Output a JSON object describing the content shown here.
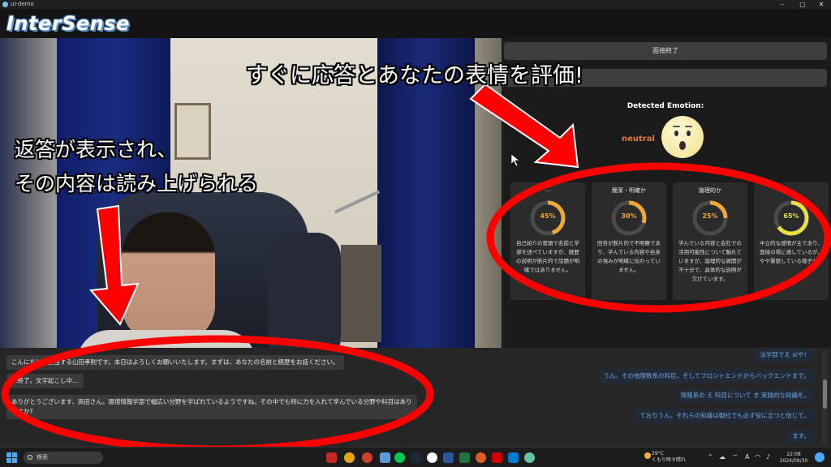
{
  "window": {
    "title": "ui-demo",
    "controls": [
      "–",
      "▢",
      "✕"
    ]
  },
  "app": {
    "logo": "InterSense"
  },
  "captions": {
    "top_right": "すぐに応答とあなたの表情を評価!",
    "left_line1": "返答が表示され、",
    "left_line2": "その内容は読み上げられる"
  },
  "panel": {
    "end_button": "面接終了",
    "second_button": "",
    "emotion_label": "Detected Emotion:",
    "emotion_value": "neutral",
    "cards": [
      {
        "title": "…",
        "percent": 45,
        "percent_label": "45%",
        "color": "#f0a830",
        "body": "自己紹介の冒頭で名前と学部を述べていますが、経歴の説明が断片的で話題が明確ではありません。"
      },
      {
        "title": "簡潔・明確か",
        "percent": 30,
        "percent_label": "30%",
        "color": "#f0a830",
        "body": "回答が断片的で不明瞭であり、学んでいる内容や自身の強みが明確に伝わっていません。"
      },
      {
        "title": "論理的か",
        "percent": 25,
        "percent_label": "25%",
        "color": "#f0a830",
        "body": "学んでいる内容と会社での活用可能性について触れていますが、論理的な展開が不十分で、具体的な説明が欠けています。"
      },
      {
        "title": "…",
        "percent": 65,
        "percent_label": "65%",
        "color": "#e8e040",
        "body": "中立的な感情が主であり、面接の場に適しているが、やや緊張している様子が…"
      }
    ]
  },
  "chat": {
    "left_messages": [
      "こんにちは…担当する山田孝則です。本日はよろしくお願いいたします。まずは、あなたの名前と経歴をお話ください。",
      "…終了。文字起こし中…",
      "ありがとうございます、高田さん。現境情報学部で幅広い分野を学ばれているようですね。その中でも特に力を入れて学んでいる分野や科目はありますか?"
    ],
    "right_messages": [
      "法学部でえ aiや！",
      "うん、その他理数系の科目。そしてフロントエンドからバックエンドまで。",
      "情報系の え 科目について ま 実践的な知識を。",
      "ておりうん。それらの知識は御社でも必ず役に立つと信じて。",
      "ます。"
    ]
  },
  "taskbar": {
    "search_placeholder": "検索",
    "weather_temp": "29°C",
    "weather_desc": "くもり時々晴れ",
    "tray_lang": "A",
    "time": "22:08",
    "date": "2024/09/30"
  },
  "colors": {
    "accent": "#f0a830",
    "emotion": "#e07a3a",
    "annotation": "#ff0000"
  }
}
